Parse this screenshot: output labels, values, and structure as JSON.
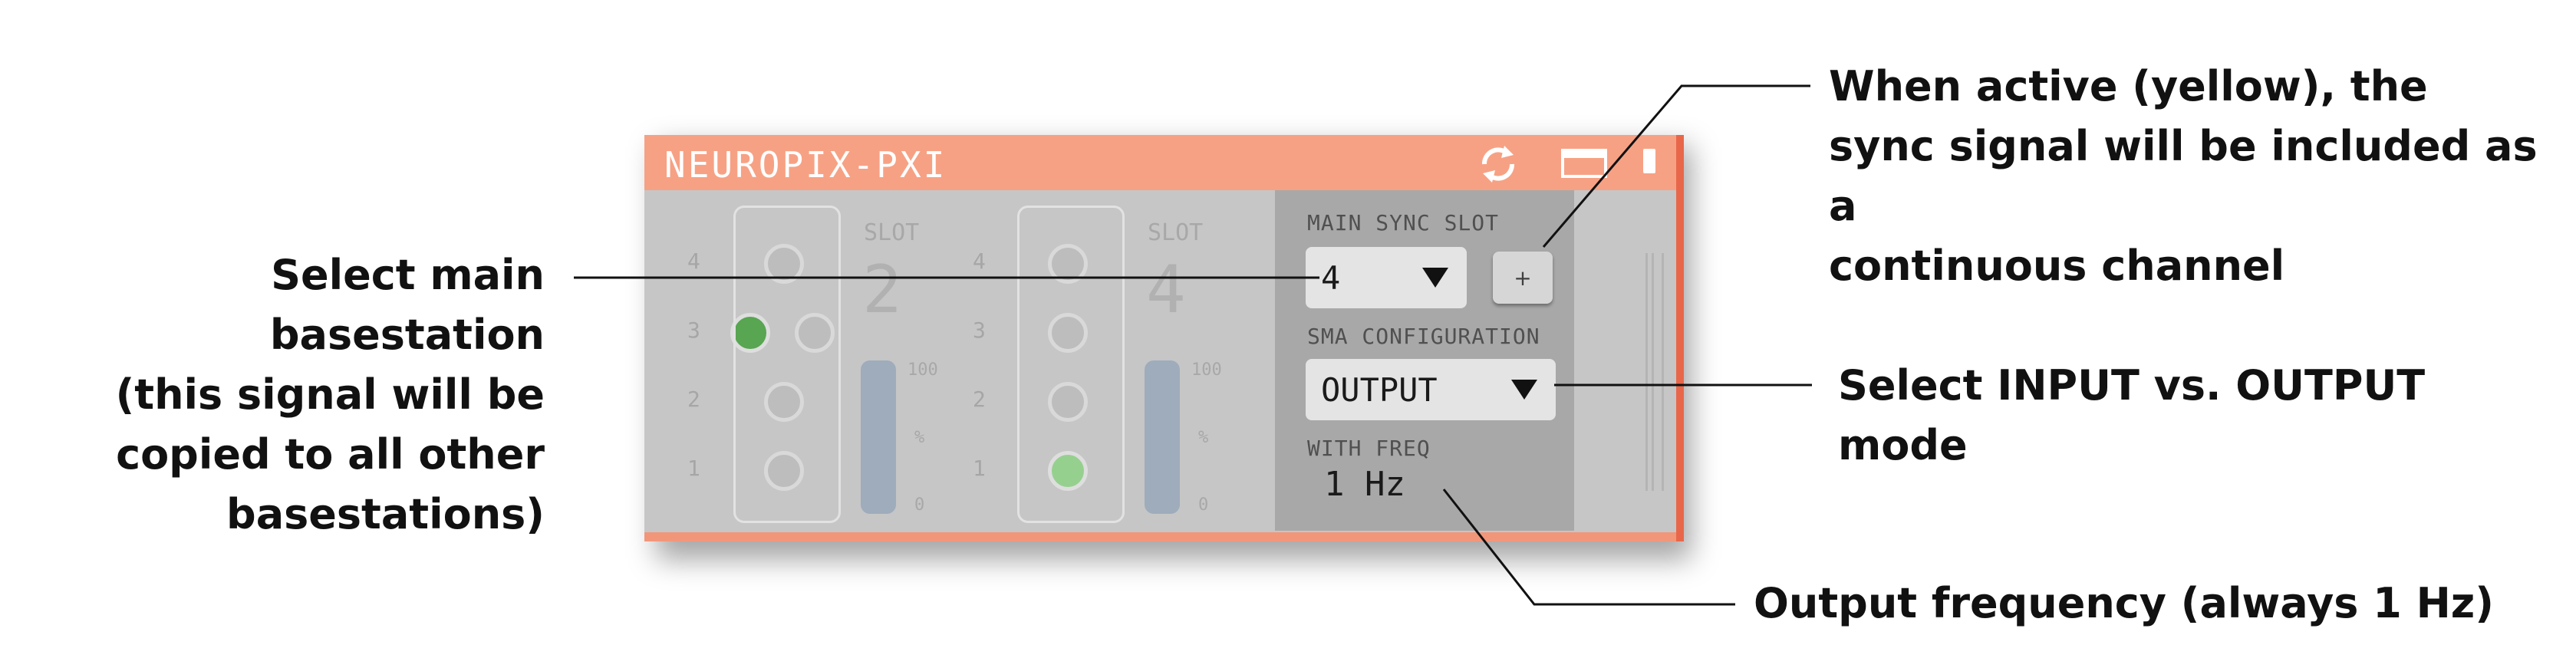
{
  "window": {
    "title": "NEUROPIX-PXI",
    "icons": [
      "sync-icon",
      "window-icon",
      "tab-icon"
    ]
  },
  "slots": [
    {
      "label": "SLOT",
      "number": "2",
      "port_numbers": [
        "4",
        "3",
        "2",
        "1"
      ],
      "meter": {
        "max": "100",
        "unit": "%",
        "min": "0"
      }
    },
    {
      "label": "SLOT",
      "number": "4",
      "port_numbers": [
        "4",
        "3",
        "2",
        "1"
      ],
      "meter": {
        "max": "100",
        "unit": "%",
        "min": "0"
      }
    }
  ],
  "sync": {
    "main_sync_slot_label": "MAIN SYNC SLOT",
    "main_sync_slot_value": "4",
    "plus_label": "+",
    "sma_config_label": "SMA CONFIGURATION",
    "sma_config_value": "OUTPUT",
    "with_freq_label": "WITH FREQ",
    "freq_value": "1 Hz"
  },
  "annotations": {
    "basestation_lines": [
      "Select main basestation",
      "(this signal will be",
      "copied to all other",
      "basestations)"
    ],
    "sync_active_lines": [
      "When active (yellow), the",
      "sync signal will be included as a",
      "continuous channel"
    ],
    "mode_lines": [
      "Select INPUT vs. OUTPUT",
      "mode"
    ],
    "freq_text": "Output frequency (always 1 Hz)"
  },
  "colors": {
    "title_bar": "#f7a184",
    "panel_bg": "#c6c6c6",
    "sync_panel_bg": "#a8a8a8",
    "port_active": "#58a552",
    "port_active_light": "#96d08f",
    "meter": "#9eacbc"
  }
}
